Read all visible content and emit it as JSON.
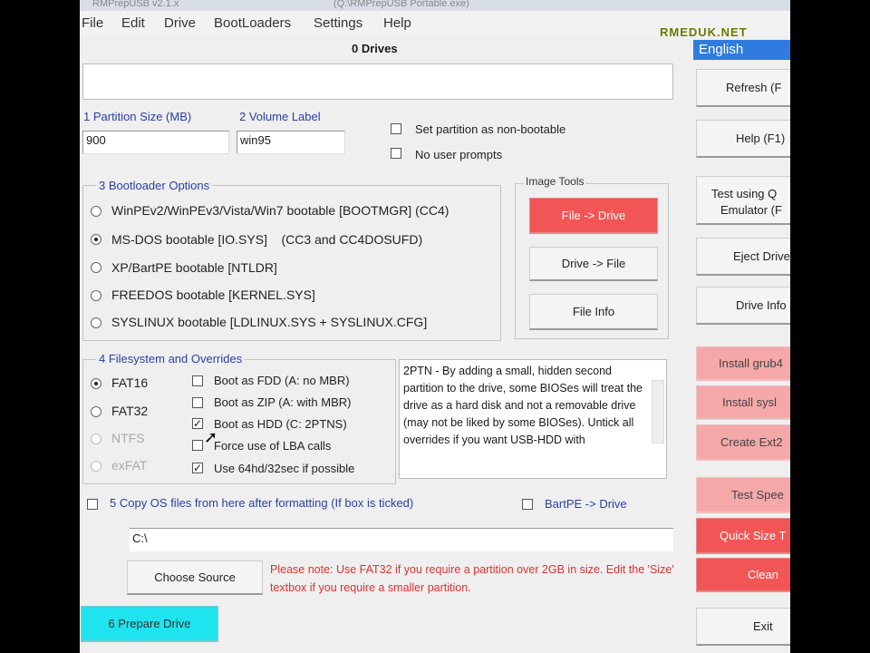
{
  "window": {
    "title_left": "RMPrepUSB v2.1.x",
    "title_right": "(Q:\\RMPrepUSB Portable.exe)"
  },
  "menu": [
    "File",
    "Edit",
    "Drive",
    "BootLoaders",
    "Settings",
    "Help"
  ],
  "site_logo": "RMEDUK.NET",
  "language": "English",
  "drives_title": "0 Drives",
  "partition": {
    "size_label": "1 Partition Size (MB)",
    "size_value": "900",
    "volume_label": "2 Volume Label",
    "volume_value": "win95"
  },
  "options": {
    "non_bootable": "Set partition as non-bootable",
    "no_prompts": "No user prompts"
  },
  "bootloader": {
    "title": "3 Bootloader Options",
    "items": [
      "WinPEv2/WinPEv3/Vista/Win7 bootable [BOOTMGR] (CC4)",
      "MS-DOS bootable [IO.SYS]    (CC3 and CC4DOSUFD)",
      "XP/BartPE bootable [NTLDR]",
      "FREEDOS bootable [KERNEL.SYS]",
      "SYSLINUX bootable [LDLINUX.SYS + SYSLINUX.CFG]"
    ],
    "selected": 1
  },
  "image_tools": {
    "title": "Image Tools",
    "file_to_drive": "File -> Drive",
    "drive_to_file": "Drive -> File",
    "file_info": "File Info"
  },
  "filesystem": {
    "title": "4 Filesystem and Overrides",
    "fs": [
      "FAT16",
      "FAT32",
      "NTFS",
      "exFAT"
    ],
    "selected": 0,
    "overrides": [
      "Boot as FDD (A: no MBR)",
      "Boot as ZIP (A: with MBR)",
      "Boot as HDD (C: 2PTNS)",
      "Force use of LBA calls",
      "Use 64hd/32sec if possible"
    ],
    "checked": [
      false,
      false,
      true,
      false,
      true
    ]
  },
  "description": "2PTN - By adding a small, hidden second partition to the drive, some BIOSes will treat the drive as a hard disk and not a removable drive (may not be liked by some BIOSes). Untick all overrides if you want USB-HDD with",
  "copy_os": {
    "label": "5 Copy OS files from here after formatting (If box is ticked)",
    "bartpe": "BartPE -> Drive",
    "source_path": "C:\\"
  },
  "choose_source": "Choose Source",
  "note": "Please note: Use FAT32 if you require a partition over 2GB in size. Edit the 'Size' textbox if you require a smaller partition.",
  "prepare_drive": "6 Prepare Drive",
  "side_buttons": {
    "refresh": "Refresh (F",
    "help": "Help (F1)",
    "test_qemu_1": "Test using Q",
    "test_qemu_2": "Emulator (F",
    "eject": "Eject Drive",
    "drive_info": "Drive Info",
    "install_grub": "Install grub4",
    "install_syslinux": "Install sysl",
    "create_ext": "Create Ext2",
    "test_speed": "Test Spee",
    "quick_size": "Quick Size T",
    "clean": "Clean",
    "exit": "Exit"
  },
  "colors": {
    "red_button": "#f25555",
    "pink_button": "#f5a8a8",
    "cyan_button": "#1fe3ee",
    "label_blue": "#2a3fa8",
    "note_red": "#e03030",
    "language_blue": "#2f7be0"
  }
}
